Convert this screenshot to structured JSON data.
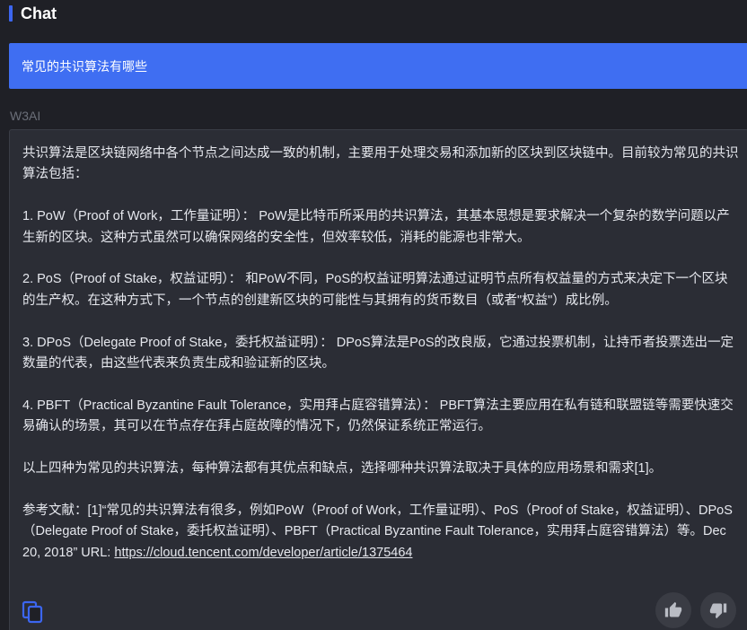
{
  "header": {
    "title": "Chat"
  },
  "user_message": {
    "text": "常见的共识算法有哪些"
  },
  "assistant": {
    "name": "W3AI",
    "paragraphs": [
      "共识算法是区块链网络中各个节点之间达成一致的机制，主要用于处理交易和添加新的区块到区块链中。目前较为常见的共识算法包括：",
      "1. PoW（Proof of Work，工作量证明）： PoW是比特币所采用的共识算法，其基本思想是要求解决一个复杂的数学问题以产生新的区块。这种方式虽然可以确保网络的安全性，但效率较低，消耗的能源也非常大。",
      "2. PoS（Proof of Stake，权益证明）： 和PoW不同，PoS的权益证明算法通过证明节点所有权益量的方式来决定下一个区块的生产权。在这种方式下，一个节点的创建新区块的可能性与其拥有的货币数目（或者\"权益\"）成比例。",
      "3. DPoS（Delegate Proof of Stake，委托权益证明）： DPoS算法是PoS的改良版，它通过投票机制，让持币者投票选出一定数量的代表，由这些代表来负责生成和验证新的区块。",
      "4. PBFT（Practical Byzantine Fault Tolerance，实用拜占庭容错算法）： PBFT算法主要应用在私有链和联盟链等需要快速交易确认的场景，其可以在节点存在拜占庭故障的情况下，仍然保证系统正常运行。",
      "以上四种为常见的共识算法，每种算法都有其优点和缺点，选择哪种共识算法取决于具体的应用场景和需求[1]。"
    ],
    "reference_text": "参考文献：[1]“常见的共识算法有很多，例如PoW（Proof of Work，工作量证明）、PoS（Proof of Stake，权益证明）、DPoS（Delegate Proof of Stake，委托权益证明）、PBFT（Practical Byzantine Fault Tolerance，实用拜占庭容错算法）等。Dec 20, 2018” URL: ",
    "reference_url": "https://cloud.tencent.com/developer/article/1375464"
  },
  "icons": {
    "copy": "copy-icon",
    "like": "thumbs-up-icon",
    "dislike": "thumbs-down-icon"
  },
  "colors": {
    "background": "#1f2026",
    "accent": "#3c66f0",
    "user_bubble": "#3f6ef2",
    "card": "#2b2d35",
    "copy_icon": "#3c66f0",
    "muted_label": "#6b6f79"
  }
}
